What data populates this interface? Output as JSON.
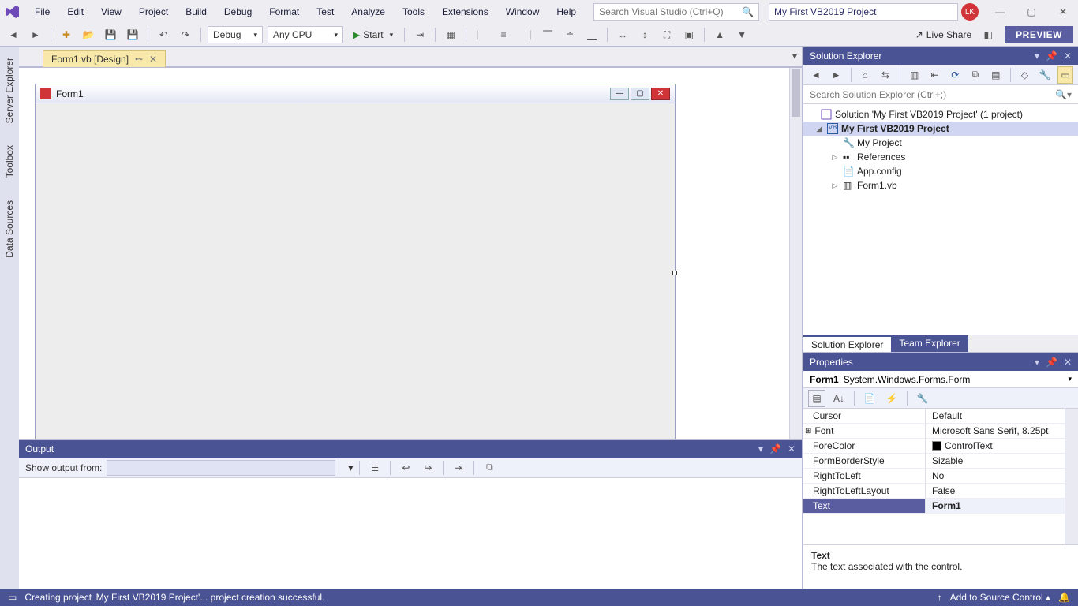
{
  "menu": [
    "File",
    "Edit",
    "View",
    "Project",
    "Build",
    "Debug",
    "Format",
    "Test",
    "Analyze",
    "Tools",
    "Extensions",
    "Window",
    "Help"
  ],
  "search": {
    "placeholder": "Search Visual Studio (Ctrl+Q)"
  },
  "solution_title": "My First VB2019 Project",
  "avatar": "LK",
  "toolbar": {
    "config": "Debug",
    "platform": "Any CPU",
    "start": "Start",
    "live_share": "Live Share",
    "preview": "PREVIEW"
  },
  "doc_tab": {
    "label": "Form1.vb [Design]"
  },
  "left_tabs": [
    "Server Explorer",
    "Toolbox",
    "Data Sources"
  ],
  "designer_form": {
    "title": "Form1"
  },
  "output": {
    "title": "Output",
    "show_from": "Show output from:"
  },
  "solution_explorer": {
    "title": "Solution Explorer",
    "search_placeholder": "Search Solution Explorer (Ctrl+;)",
    "root": "Solution 'My First VB2019 Project' (1 project)",
    "project": "My First VB2019 Project",
    "items": [
      "My Project",
      "References",
      "App.config",
      "Form1.vb"
    ],
    "tabs": [
      "Solution Explorer",
      "Team Explorer"
    ]
  },
  "properties": {
    "title": "Properties",
    "object": "Form1",
    "type": "System.Windows.Forms.Form",
    "rows": [
      {
        "name": "Cursor",
        "value": "Default"
      },
      {
        "name": "Font",
        "value": "Microsoft Sans Serif, 8.25pt",
        "exp": true
      },
      {
        "name": "ForeColor",
        "value": "ControlText",
        "swatch": true
      },
      {
        "name": "FormBorderStyle",
        "value": "Sizable"
      },
      {
        "name": "RightToLeft",
        "value": "No"
      },
      {
        "name": "RightToLeftLayout",
        "value": "False"
      },
      {
        "name": "Text",
        "value": "Form1",
        "selected": true
      }
    ],
    "desc_title": "Text",
    "desc_body": "The text associated with the control."
  },
  "status": {
    "msg": "Creating project 'My First VB2019 Project'... project creation successful.",
    "src": "Add to Source Control"
  }
}
